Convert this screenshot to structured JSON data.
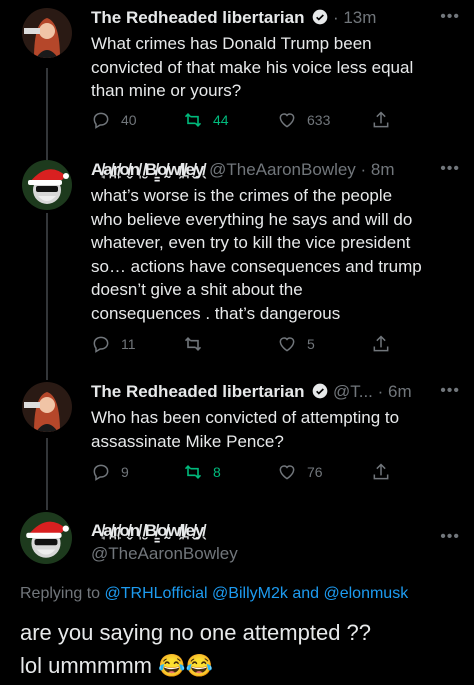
{
  "tweets": [
    {
      "name": "The Redheaded libertarian",
      "handle": "",
      "time": "· 13m",
      "text": [
        "What crimes has Donald Trump been",
        "convicted of that make his voice less equal",
        "than mine or yours?"
      ],
      "replies": "40",
      "retweets": "44",
      "likes": "633"
    },
    {
      "name": "A̸̘a̸̪r̸̙o̸̬n̸̩ ̸̮B̸̳o̸̰w̸̗l̸̪e̸̬y̸̖",
      "handle": "@TheAaronBowley · 8m",
      "text": [
        "what’s worse is the crimes of the people",
        "who believe everything he says and will do",
        "whatever, even try to kill the vice president",
        "so… actions have consequences and trump",
        "doesn’t give a shit about the",
        "consequences . that’s dangerous"
      ],
      "replies": "11",
      "retweets": "",
      "likes": "5"
    },
    {
      "name": "The Redheaded libertarian",
      "handle": "@T...",
      "time": "· 6m",
      "text": [
        "Who has been convicted of attempting to",
        "assassinate Mike Pence?"
      ],
      "replies": "9",
      "retweets": "8",
      "likes": "76"
    }
  ],
  "main_tweet": {
    "name": "A̸̘a̸̪r̸̙o̸̬n̸̩ ̸̮B̸̳o̸̰w̸̗l̸̪e̸̬y̸̖",
    "handle": "@TheAaronBowley",
    "replying_prefix": "Replying to",
    "mention1": "@TRHLofficial",
    "mention2": "@BillyM2k",
    "and_text": "and",
    "mention3": "@elonmusk",
    "text_line1": "are you saying no one attempted ??",
    "text_line2": "lol ummmmm 😂😂"
  },
  "icons": {
    "reply": "reply-icon",
    "retweet": "retweet-icon",
    "like": "heart-icon",
    "share": "share-icon",
    "more": "more-icon",
    "verified": "verified-badge-icon"
  },
  "colors": {
    "background": "#000000",
    "text": "#e7e9ea",
    "muted": "#71767b",
    "accent": "#1d9bf0",
    "retweet_green": "#00ba7c"
  }
}
